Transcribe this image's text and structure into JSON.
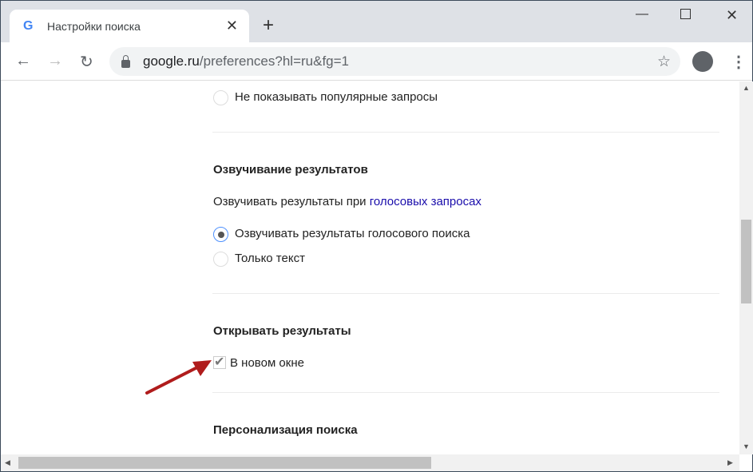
{
  "browser": {
    "tab_title": "Настройки поиска",
    "url_host": "google.ru",
    "url_path": "/preferences?hl=ru&fg=1"
  },
  "content": {
    "option_no_popular": "Не показывать популярные запросы",
    "voice_heading": "Озвучивание результатов",
    "voice_desc": "Озвучивать результаты при ",
    "voice_link": "голосовых запросах",
    "voice_opt1": "Озвучивать результаты голосового поиска",
    "voice_opt2": "Только текст",
    "voice_selected": "Озвучивать результаты голосового поиска",
    "open_heading": "Открывать результаты",
    "open_new_window": "В новом окне",
    "open_new_window_checked": true,
    "personal_heading": "Персонализация поиска"
  },
  "colors": {
    "link": "#1a0dab",
    "annotation_arrow": "#b01c1c"
  }
}
